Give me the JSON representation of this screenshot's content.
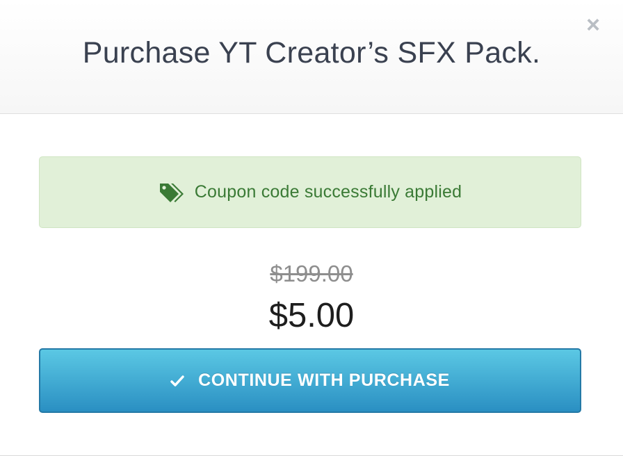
{
  "modal": {
    "title": "Purchase YT Creator’s SFX Pack.",
    "close_icon": "close-icon",
    "close_glyph": "×"
  },
  "coupon": {
    "icon": "tags-icon",
    "message": "Coupon code successfully applied"
  },
  "pricing": {
    "original_price": "$199.00",
    "discounted_price": "$5.00"
  },
  "actions": {
    "continue_icon": "check-icon",
    "continue_label": "CONTINUE WITH PURCHASE"
  },
  "colors": {
    "alert_bg": "#e1f0d8",
    "alert_text": "#3a7a35",
    "button_top": "#5bc8e4",
    "button_bottom": "#2a8fc2"
  }
}
